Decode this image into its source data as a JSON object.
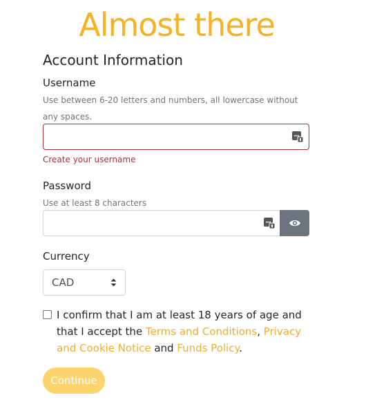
{
  "page": {
    "heading": "Almost there",
    "section_title": "Account Information"
  },
  "username": {
    "label": "Username",
    "help": "Use between 6-20 letters and numbers, all lowercase without any spaces.",
    "value": "",
    "error": "Create your username"
  },
  "password": {
    "label": "Password",
    "help": "Use at least 8 characters",
    "value": ""
  },
  "currency": {
    "label": "Currency",
    "selected": "CAD"
  },
  "consent": {
    "text_1": "I confirm that I am at least 18 years of age and that I accept the ",
    "terms_link": "Terms and Conditions",
    "sep_1": ", ",
    "privacy_link": "Privacy and Cookie Notice",
    "sep_2": " and ",
    "funds_link": "Funds Policy",
    "end": ".",
    "checked": false
  },
  "actions": {
    "continue_label": "Continue"
  },
  "colors": {
    "heading": "#f5b323",
    "link": "#f0ad2e",
    "error": "#a23240",
    "button": "#fdd36d",
    "eye_button": "#6c757d"
  },
  "icons": {
    "password_manager": "password-manager-icon",
    "eye": "eye-icon",
    "select": "sort-arrows-icon"
  }
}
